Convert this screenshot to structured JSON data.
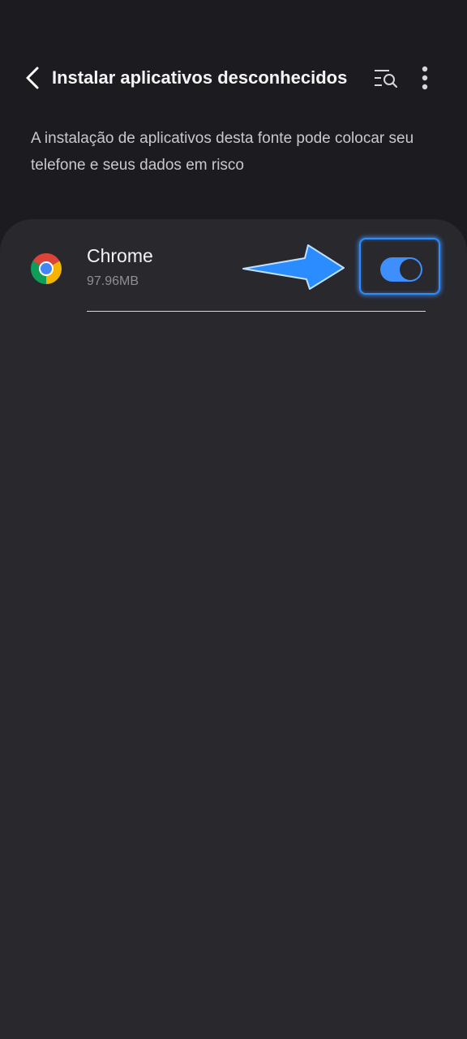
{
  "header": {
    "title": "Instalar aplicativos desconhecidos",
    "icons": {
      "back": "back-arrow-icon",
      "search": "search-list-icon",
      "more": "more-vertical-icon"
    }
  },
  "description": "A instalação de aplicativos desta fonte pode colocar seu telefone e seus dados em risco",
  "apps": [
    {
      "name": "Chrome",
      "size": "97.96MB",
      "icon": "chrome-icon",
      "allowed": true
    }
  ],
  "colors": {
    "background": "#1c1c20",
    "card": "#28282d",
    "toggle_on": "#3e8ffb",
    "annotation": "#2b8dff"
  }
}
